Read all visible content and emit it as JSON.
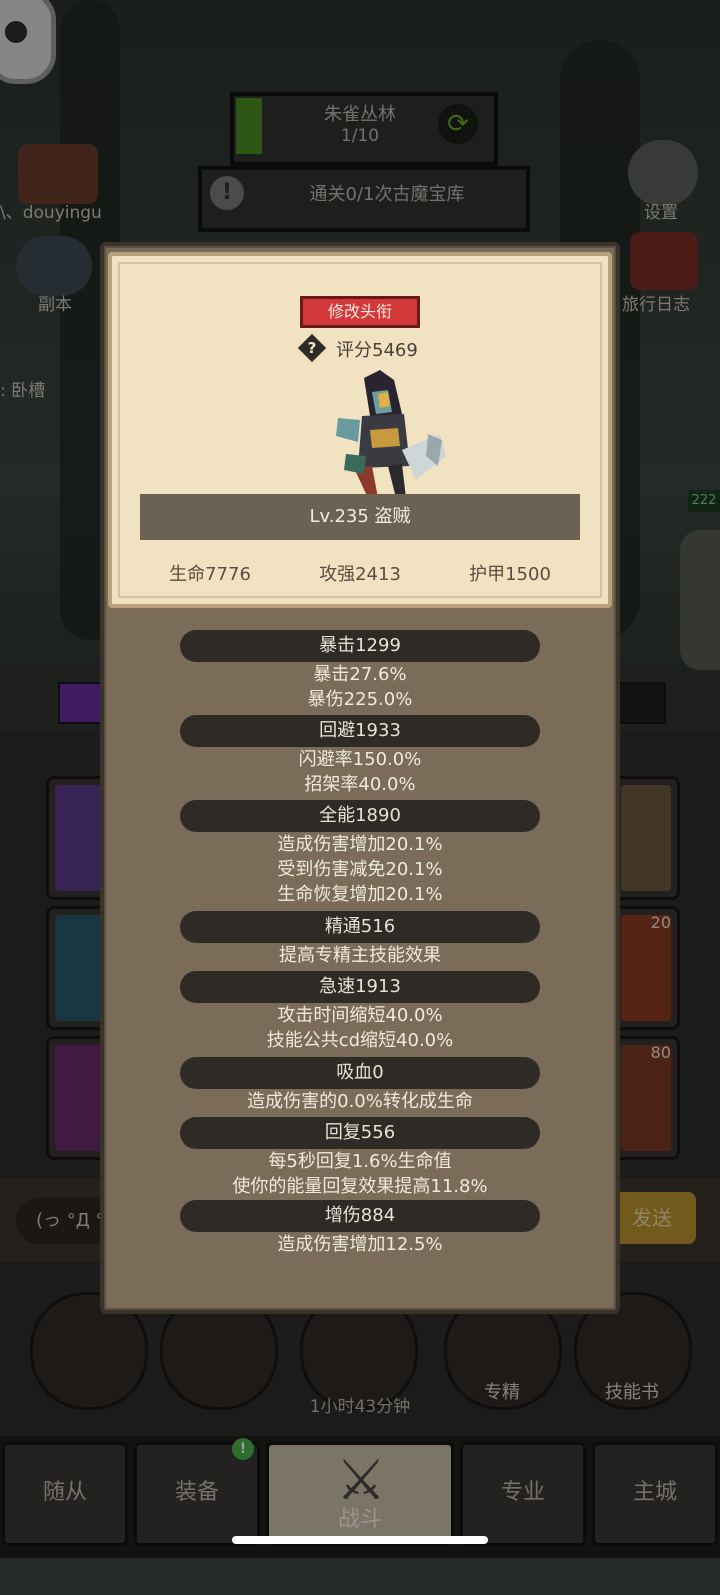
{
  "background": {
    "area": {
      "name": "朱雀丛林",
      "progress": "1/10"
    },
    "quest": {
      "icon": "alert-icon",
      "mark": "!",
      "text": "通关0/1次古魔宝库"
    },
    "player_name_fragment": "\\、douyingu",
    "left_menu": {
      "dungeon": "副本",
      "title_fragment": ": 卧槽"
    },
    "right_menu": {
      "settings": "设置",
      "travel_log": "旅行日志",
      "badge": "222"
    },
    "slot_counts": {
      "slot_2": "20",
      "slot_3": "80"
    },
    "chat": {
      "input_fragment": "(っ °Д °",
      "send_fragment": "发送"
    },
    "round_buttons": {
      "specialty": "专精",
      "skill_book": "技能书"
    },
    "timer": "1小时43分钟",
    "nav": {
      "follower": "随从",
      "equipment": "装备",
      "battle": "战斗",
      "profession": "专业",
      "main_city": "主城",
      "notif": "!"
    }
  },
  "panel": {
    "title_button": "修改头衔",
    "score": "评分5469",
    "level_class": "Lv.235 盗贼",
    "main_stats": {
      "hp": "生命7776",
      "attack": "攻强2413",
      "armor": "护甲1500"
    },
    "stats": [
      {
        "head": "暴击1299",
        "lines": [
          "暴击27.6%",
          "暴伤225.0%"
        ]
      },
      {
        "head": "回避1933",
        "lines": [
          "闪避率150.0%",
          "招架率40.0%"
        ]
      },
      {
        "head": "全能1890",
        "lines": [
          "造成伤害增加20.1%",
          "受到伤害减免20.1%",
          "生命恢复增加20.1%"
        ]
      },
      {
        "head": "精通516",
        "lines": [
          "提高专精主技能效果"
        ]
      },
      {
        "head": "急速1913",
        "lines": [
          "攻击时间缩短40.0%",
          "技能公共cd缩短40.0%"
        ]
      },
      {
        "head": "吸血0",
        "lines": [
          "造成伤害的0.0%转化成生命"
        ]
      },
      {
        "head": "回复556",
        "lines": [
          "每5秒回复1.6%生命值",
          "使你的能量回复效果提高11.8%"
        ]
      },
      {
        "head": "增伤884",
        "lines": [
          "造成伤害增加12.5%"
        ]
      }
    ]
  },
  "colors": {
    "accent_red": "#d3383a",
    "parchment": "#f1e2c2",
    "panel_brown": "#7a6c58",
    "stat_pill": "#2e2a26",
    "green": "#4a8c22"
  }
}
